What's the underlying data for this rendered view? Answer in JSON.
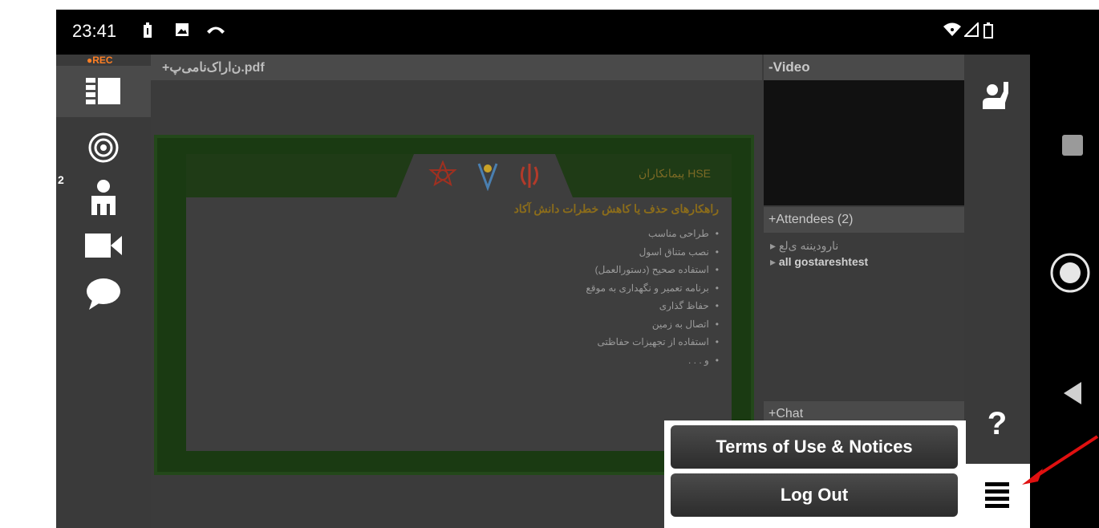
{
  "status_bar": {
    "time": "23:41",
    "icons": [
      "battery-saver-icon",
      "image-icon",
      "call-icon",
      "wifi-icon",
      "signal-icon",
      "battery-icon"
    ]
  },
  "left_toolbar": {
    "rec_label": "●REC",
    "items": [
      {
        "name": "layout-icon",
        "active": true
      },
      {
        "name": "target-icon"
      },
      {
        "name": "attendees-icon",
        "badge": "2"
      },
      {
        "name": "camera-icon"
      },
      {
        "name": "chat-bubble-icon"
      }
    ]
  },
  "document": {
    "tab_label": "+ن‌اراک‌نامی‌پ.pdf",
    "slide": {
      "header_title": "HSE پیمانکاران",
      "heading": "راهکارهای حذف یا کاهش خطرات دانش آکاد",
      "bullets": [
        "طراحی مناسب",
        "نصب متناق اسول",
        "استفاده صحیح (دستورالعمل)",
        "برنامه تعمیر و نگهداری به موقع",
        "حفاظ گذاری",
        "اتصال به زمین",
        "استفاده از تجهیزات حفاظتی",
        "و . . ."
      ]
    }
  },
  "right_panel": {
    "video_title": "-Video",
    "attendees_title": "+Attendees",
    "attendees_count": "(2)",
    "attendees": [
      {
        "name": "نارودیننه ی‌لع",
        "bold": false
      },
      {
        "name": "all gostareshtest",
        "bold": true
      }
    ],
    "chat_title": "+Chat"
  },
  "actions": {
    "items": [
      "raise-hand-icon",
      "help-icon",
      "hamburger-menu-icon"
    ],
    "help_label": "?"
  },
  "popup_menu": {
    "items": [
      "Terms of Use & Notices",
      "Log Out"
    ]
  },
  "colors": {
    "accent_rec": "#ff7f24",
    "arrow": "#e01010",
    "panel_bg": "#3b3b3b",
    "toolbar_bg": "#3a3a3a"
  }
}
